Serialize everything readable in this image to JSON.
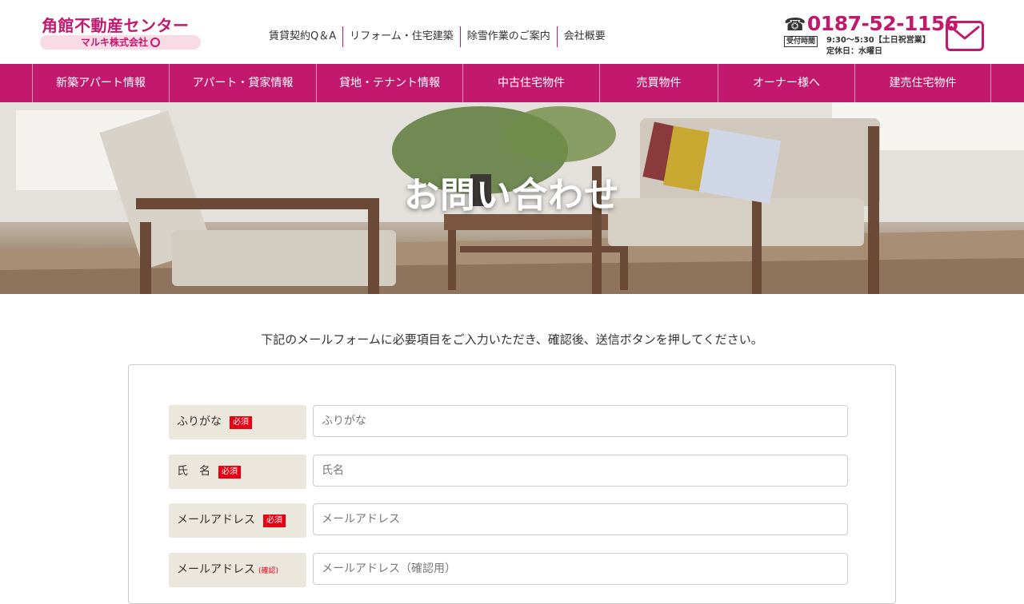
{
  "header": {
    "logo_main": "角館不動産センター",
    "logo_sub": "マルキ株式会社",
    "top_links": [
      "賃貸契約Q＆A",
      "リフォーム・住宅建築",
      "除雪作業のご案内",
      "会社概要"
    ],
    "phone_icon": "telephone-icon",
    "phone": "0187-52-1156",
    "hours_badge": "受付時間",
    "hours": "9:30〜5:30【土日祝営業】",
    "closed": "定休日：水曜日",
    "mail_icon": "mail-icon"
  },
  "mainnav": {
    "items": [
      "新築アパート情報",
      "アパート・貸家情報",
      "貸地・テナント情報",
      "中古住宅物件",
      "売買物件",
      "オーナー様へ",
      "建売住宅物件"
    ]
  },
  "hero": {
    "title": "お問い合わせ"
  },
  "intro": "下記のメールフォームに必要項目をご入力いただき、確認後、送信ボタンを押してください。",
  "form": {
    "required_label": "必須",
    "confirm_label": "(確認)",
    "fields": [
      {
        "label": "ふりがな",
        "placeholder": "ふりがな"
      },
      {
        "label": "氏　名",
        "placeholder": "氏名"
      },
      {
        "label": "メールアドレス",
        "placeholder": "メールアドレス"
      },
      {
        "label": "メールアドレス",
        "placeholder": "メールアドレス（確認用）"
      }
    ]
  },
  "colors": {
    "brand": "#c2186d",
    "required": "#e60012",
    "label_bg": "#ebe7dc"
  }
}
